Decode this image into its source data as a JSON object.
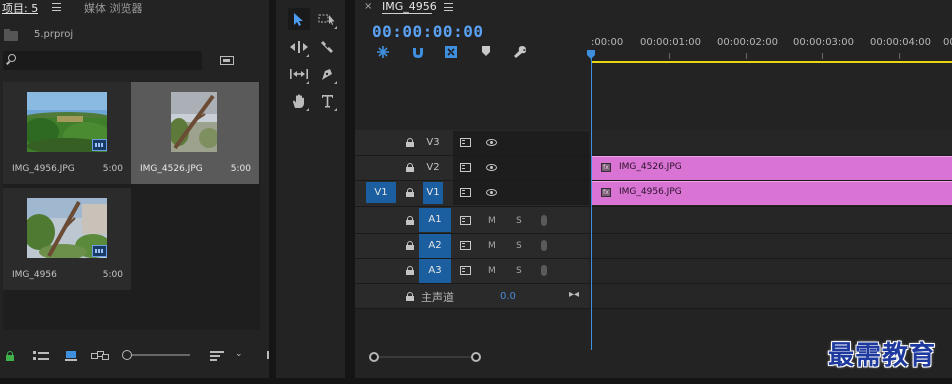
{
  "project_panel": {
    "tabs": [
      {
        "label": "项目: 5"
      },
      {
        "label": "媒体 浏览器"
      }
    ],
    "project_file": "5.prproj",
    "search_placeholder": "",
    "items": [
      {
        "name": "IMG_4956.JPG",
        "duration": "5:00",
        "selected": false
      },
      {
        "name": "IMG_4526.JPG",
        "duration": "5:00",
        "selected": true
      },
      {
        "name": "IMG_4956",
        "duration": "5:00",
        "selected": false
      }
    ]
  },
  "timeline": {
    "sequence_name": "IMG_4956",
    "timecode": "00:00:00:00",
    "ruler_labels": [
      ":00:00",
      "00:00:01:00",
      "00:00:02:00",
      "00:00:03:00",
      "00:00:04:00",
      "00:0"
    ],
    "source_patch": "V1",
    "video_tracks": [
      {
        "name": "V3",
        "targeted": false
      },
      {
        "name": "V2",
        "targeted": false
      },
      {
        "name": "V1",
        "targeted": true
      }
    ],
    "audio_tracks": [
      {
        "name": "A1",
        "m": "M",
        "s": "S"
      },
      {
        "name": "A2",
        "m": "M",
        "s": "S"
      },
      {
        "name": "A3",
        "m": "M",
        "s": "S"
      }
    ],
    "clips": [
      {
        "track": "V2",
        "label": "IMG_4526.JPG"
      },
      {
        "track": "V1",
        "label": "IMG_4956.JPG"
      }
    ],
    "master": {
      "label": "主声道",
      "value": "0.0"
    },
    "colors": {
      "accent": "#3f8fdf",
      "clip": "#d974d5",
      "work_area": "#e8d60f"
    }
  },
  "watermark": "最需教育"
}
